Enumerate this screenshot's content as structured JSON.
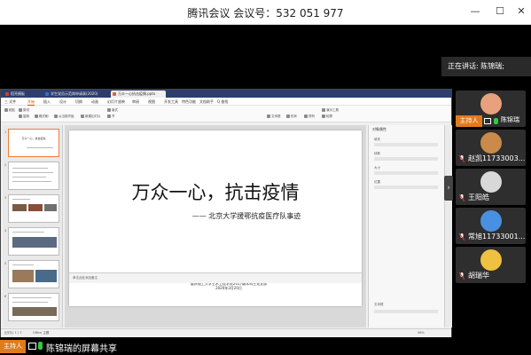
{
  "window": {
    "title": "腾讯会议 会议号：532 051 977",
    "minimize": "—",
    "maximize": "☐",
    "close": "✕"
  },
  "wps": {
    "tabs": [
      {
        "label": "稻壳模板",
        "color": "#d23f31"
      },
      {
        "label": "学生党员示范岗申请表(2020)",
        "color": "#2e6fd6"
      },
      {
        "label": "万众一心抗击疫情.pptx",
        "color": "#e6632a"
      }
    ],
    "menus": [
      "三 文件",
      "开始",
      "插入",
      "设计",
      "切换",
      "动画",
      "幻灯片放映",
      "审阅",
      "视图",
      "开发工具",
      "特色功能",
      "文档助手",
      "Q 查找"
    ],
    "active_menu": "开始",
    "ribbon_left": [
      "粘贴",
      "剪切",
      "复制",
      "格式刷"
    ],
    "ribbon_mid": [
      "从当前开始",
      "新建幻灯片",
      "版式",
      "节"
    ],
    "ribbon_right": [
      "文本框",
      "形状",
      "排列",
      "轮廓",
      "演示工具"
    ],
    "thumbnails": [
      {
        "num": "1",
        "title": "万众一心，抗击疫情"
      },
      {
        "num": "2",
        "title": ""
      },
      {
        "num": "3",
        "title": ""
      },
      {
        "num": "4",
        "title": ""
      },
      {
        "num": "5",
        "title": ""
      },
      {
        "num": "6",
        "title": ""
      }
    ],
    "slide": {
      "title": "万众一心，抗击疫情",
      "subtitle": "—— 北京大学援鄂抗疫医疗队事迹",
      "org": "重庆理工大学土木工程学院2017级本科生党支部",
      "date": "2020年3月20日"
    },
    "notes_placeholder": "单击此处添加备注",
    "right_panel": {
      "title": "对象属性",
      "labels": [
        "填充",
        "线条",
        "大小",
        "位置",
        "文本框"
      ]
    },
    "status": {
      "page": "幻灯片 1 / 7",
      "theme": "Office 主题",
      "zoom": "58%"
    }
  },
  "meeting": {
    "speaking_label": "正在讲话: 陈锦瑞;",
    "participants": [
      {
        "name": "陈锦瑞",
        "host": true,
        "host_label": "主持人",
        "avatar": "#e9a07c"
      },
      {
        "name": "赵凯11733003...",
        "host": false,
        "avatar": "#c98a4a"
      },
      {
        "name": "王阳皓",
        "host": false,
        "avatar": "#d8d8d8"
      },
      {
        "name": "常旭11733001...",
        "host": false,
        "avatar": "#4a90e2"
      },
      {
        "name": "胡瑞华",
        "host": false,
        "avatar": "#f0c040"
      }
    ],
    "side_arrow": "›",
    "bottom_host_label": "主持人",
    "bottom_text": "陈锦瑞的屏幕共享"
  }
}
